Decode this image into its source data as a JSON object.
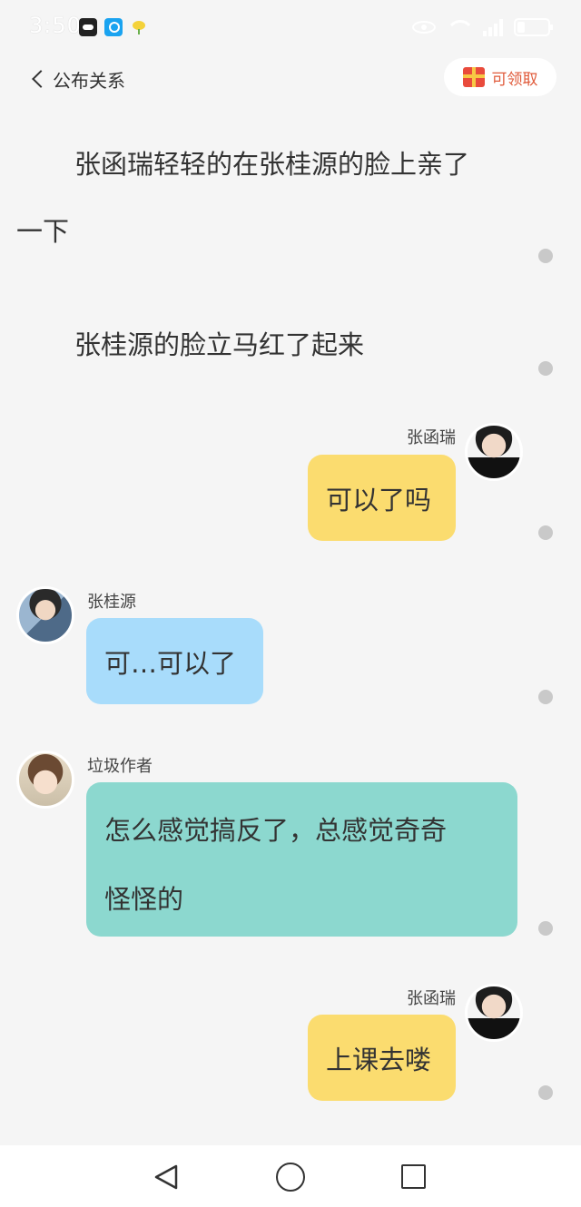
{
  "status_bar": {
    "time": "3:50",
    "app_icons": [
      "mask-app-icon",
      "search-app-icon",
      "plant-app-icon"
    ],
    "indicators": [
      "eye-icon",
      "wifi-icon",
      "signal-icon",
      "battery-icon"
    ]
  },
  "header": {
    "back_label": "公布关系",
    "claim_label": "可领取"
  },
  "narration": [
    {
      "line1": "张函瑞轻轻的在张桂源的脸上亲了",
      "line2": "一下"
    },
    {
      "text": "张桂源的脸立马红了起来"
    }
  ],
  "messages": [
    {
      "sender": "张函瑞",
      "text": "可以了吗",
      "side": "right",
      "bubble_color": "#fbdc6f"
    },
    {
      "sender": "张桂源",
      "text": "可…可以了",
      "side": "left",
      "bubble_color": "#a8dcfb"
    },
    {
      "sender": "垃圾作者",
      "line1": "怎么感觉搞反了，总感觉奇奇",
      "line2": "怪怪的",
      "side": "left",
      "bubble_color": "#8cd8cf"
    },
    {
      "sender": "张函瑞",
      "text": "上课去喽",
      "side": "right",
      "bubble_color": "#fbdc6f"
    }
  ],
  "nav_bar": {
    "buttons": [
      "back-triangle-icon",
      "home-circle-icon",
      "recents-square-icon"
    ]
  }
}
